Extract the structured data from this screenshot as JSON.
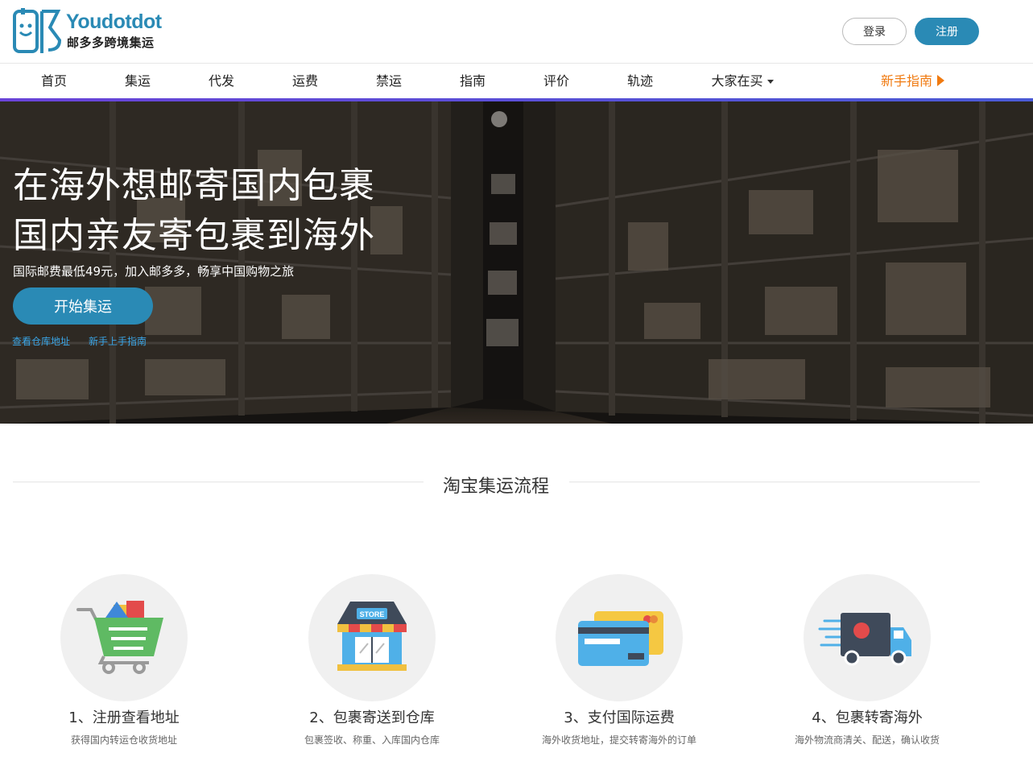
{
  "header": {
    "logo_en": "Youdotdot",
    "logo_cn": "邮多多跨境集运",
    "login_label": "登录",
    "register_label": "注册"
  },
  "nav": {
    "items": [
      "首页",
      "集运",
      "代发",
      "运费",
      "禁运",
      "指南",
      "评价",
      "轨迹",
      "大家在买"
    ],
    "guide_label": "新手指南"
  },
  "hero": {
    "title_line1": "在海外想邮寄国内包裹",
    "title_line2": "国内亲友寄包裹到海外",
    "subtitle": "国际邮费最低49元，加入邮多多，畅享中国购物之旅",
    "cta_label": "开始集运",
    "link_warehouse": "查看仓库地址",
    "link_guide": "新手上手指南"
  },
  "process": {
    "title": "淘宝集运流程",
    "steps": [
      {
        "title": "1、注册查看地址",
        "desc": "获得国内转运仓收货地址",
        "icon": "shopping-cart-icon"
      },
      {
        "title": "2、包裹寄送到仓库",
        "desc": "包裹签收、称重、入库国内仓库",
        "icon": "store-icon"
      },
      {
        "title": "3、支付国际运费",
        "desc": "海外收货地址，提交转寄海外的订单",
        "icon": "credit-card-icon"
      },
      {
        "title": "4、包裹转寄海外",
        "desc": "海外物流商清关、配送，确认收货",
        "icon": "delivery-truck-icon"
      }
    ]
  },
  "colors": {
    "brand": "#2a8ab5",
    "guide_orange": "#f07a10",
    "nav_accent": "#6a43d9",
    "link_blue": "#3aa5e6"
  }
}
